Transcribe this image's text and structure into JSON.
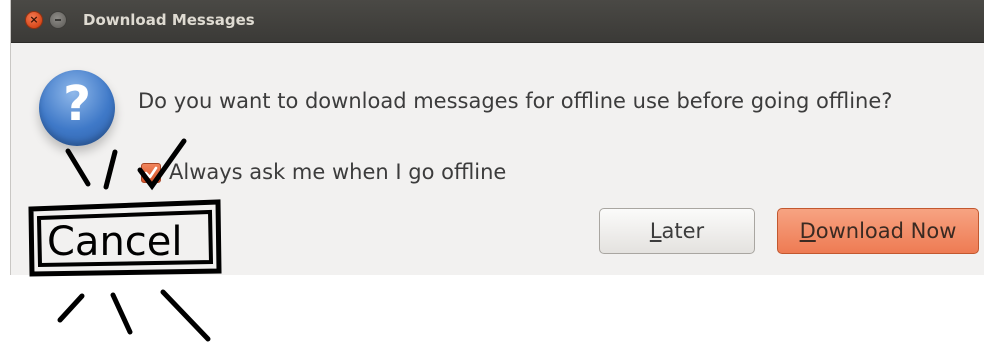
{
  "window": {
    "title": "Download Messages",
    "close_glyph": "×"
  },
  "dialog": {
    "icon": "question-icon",
    "icon_glyph": "?",
    "message": "Do you want to download messages for offline use before going offline?",
    "checkbox": {
      "label": "Always ask me when I go offline",
      "checked": true
    },
    "buttons": {
      "later": {
        "mnemonic": "L",
        "rest": "ater"
      },
      "download": {
        "mnemonic": "D",
        "rest": "ownload Now"
      }
    }
  },
  "annotation": {
    "text": "Cancel"
  },
  "colors": {
    "titlebar": "#3c3b37",
    "accent": "#ee7b53",
    "dialog_bg": "#f2f1f0"
  }
}
